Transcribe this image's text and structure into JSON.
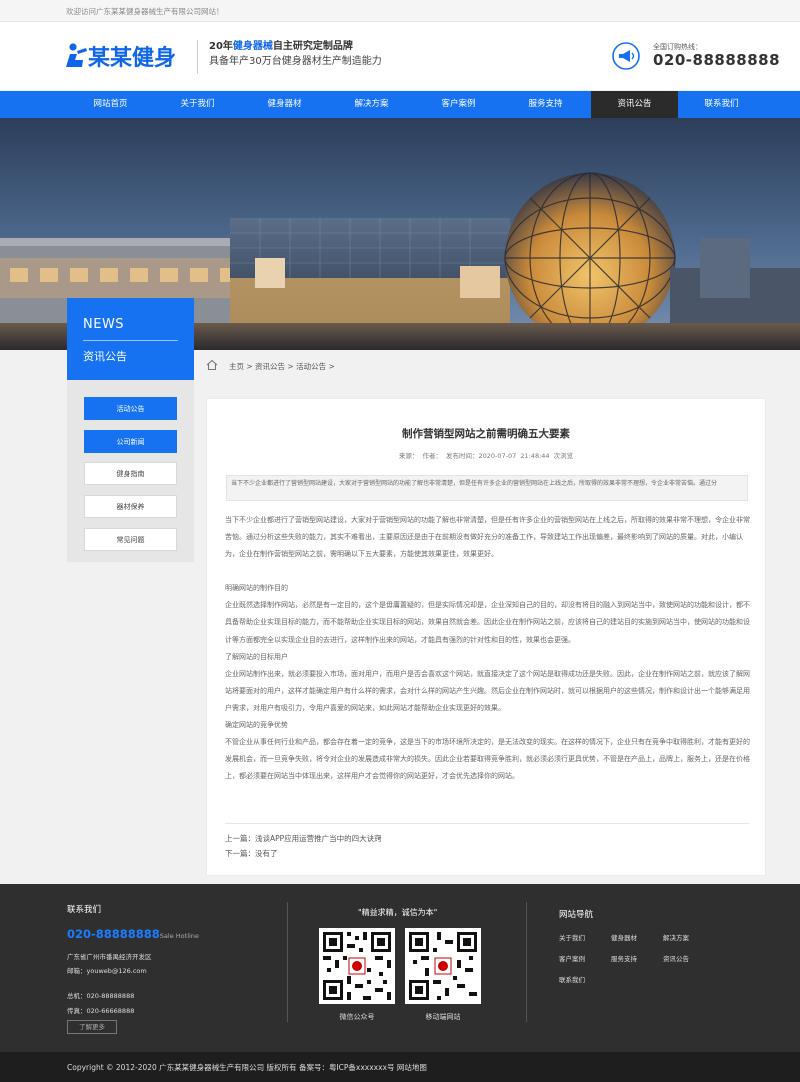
{
  "topbar": {
    "welcome": "欢迎访问广东某某健身器械生产有限公司网站！"
  },
  "header": {
    "logo_text": "某某健身",
    "tagline_prefix": "20年",
    "tagline_highlight": "健身器械",
    "tagline_suffix": "自主研究定制品牌",
    "tagline_line2": "具备年产30万台健身器材生产制造能力",
    "hotline_label": "全国订购热线：",
    "hotline_number": "020-88888888"
  },
  "nav": {
    "items": [
      "网站首页",
      "关于我们",
      "健身器材",
      "解决方案",
      "客户案例",
      "服务支持",
      "资讯公告",
      "联系我们"
    ],
    "active_index": 6
  },
  "sidebar": {
    "title_en": "NEWS",
    "title_cn": "资讯公告",
    "items": [
      "活动公告",
      "公司新闻",
      "健身指南",
      "器材保养",
      "常见问题"
    ],
    "active": [
      0,
      1
    ]
  },
  "breadcrumb": {
    "text": "主页 > 资讯公告 > 活动公告 >"
  },
  "article": {
    "title": "制作营销型网站之前需明确五大要素",
    "meta": "来源：   作者：   发布时间：2020-07-07 21:48:44     次浏览",
    "summary": "当下不少企业都进行了营销型网站建设，大家对于营销型网站的功能了解也非常清楚，但是任有许多企业的营销型网站在上线之后，所取得的效果非常不理想，令企业非常苦恼。通过分",
    "paragraphs": [
      "当下不少企业都进行了营销型网站建设，大家对于营销型网站的功能了解也非常清楚，但是任有许多企业的营销型网站在上线之后，所取得的效果非常不理想，令企业非常苦恼。通过分析这些失败的能力，其实不难看出，主要原因还是由于在前期没有做好充分的准备工作，导致建站工作出现偏差，最终影响到了网站的质量。对此，小编认为，企业在制作营销型网站之前，需明确以下五大要素，方能使其效果更佳，效果更好。",
      "",
      "明确网站的制作目的",
      "企业既然选择制作网站，必然是有一定目的，这个是毋庸置疑的，但是实际情况却是，企业深知自己的目的，却没有将目的融入到网站当中，致使网站的功能和设计，都不具备帮助企业实现目标的能力，而不能帮助企业实现目标的网站，效果自然就会差。因此企业在制作网站之前，应该将自己的建站目的实施到网站当中，使网站的功能和设计等方面都完全以实现企业目的去进行，这样制作出来的网站，才能具有强烈的针对性和目的性，效果也会更强。",
      "了解网站的目标用户",
      "企业网站制作出来，就必须要投入市场，面对用户，而用户是否会喜欢这个网站，就直接决定了这个网站是取得成功还是失败。因此，企业在制作网站之前，就应该了解网站将要面对的用户，这样才能确定用户有什么样的需求，会对什么样的网站产生兴趣。然后企业在制作网站时，就可以根据用户的这些情况，制作和设计出一个能够满足用户需求，对用户有吸引力，令用户喜爱的网站来，如此网站才能帮助企业实现更好的效果。",
      "确定网站的竞争优势",
      "不管企业从事任何行业和产品，都会存在着一定的竞争，这是当下的市场环境所决定的，是无法改变的现实。在这样的情况下，企业只有在竞争中取得胜利，才能有更好的发展机会，而一旦竞争失败，将令对企业的发展造成非常大的损失。因此企业若要取得竞争胜利，就必须必须行更具优势，不管是在产品上，品牌上，服务上，还是在价格上，都必须要在网站当中体现出来，这样用户才会觉得你的网站更好，才会优先选择你的网站。"
    ],
    "prev": "上一篇：浅谈APP应用运营推广当中的四大诀窍",
    "next": "下一篇：没有了"
  },
  "footer": {
    "contact_title": "联系我们",
    "tel": "020-88888888",
    "tel_suffix": "Sale Hotline",
    "address": "广东省广州市番禺经济开发区",
    "email": "邮箱：youweb@126.com",
    "phone": "总机：020-88888888",
    "fax": "传真：020-66668888",
    "more": "了解更多",
    "slogan": "\"精益求精，诚信为本\"",
    "qr1_label": "微信公众号",
    "qr2_label": "移动端网站",
    "sitenav_title": "网站导航",
    "sitenav_items": [
      "关于我们",
      "健身器材",
      "解决方案",
      "客户案例",
      "服务支持",
      "资讯公告",
      "联系我们"
    ]
  },
  "copyright": "Copyright © 2012-2020 广东某某健身器械生产有限公司 版权所有 备案号：粤ICP备xxxxxxx号 网站地图",
  "colors": {
    "brand": "#1672f1",
    "dark": "#2f2f2f",
    "nav_active": "#2b2b2b"
  }
}
